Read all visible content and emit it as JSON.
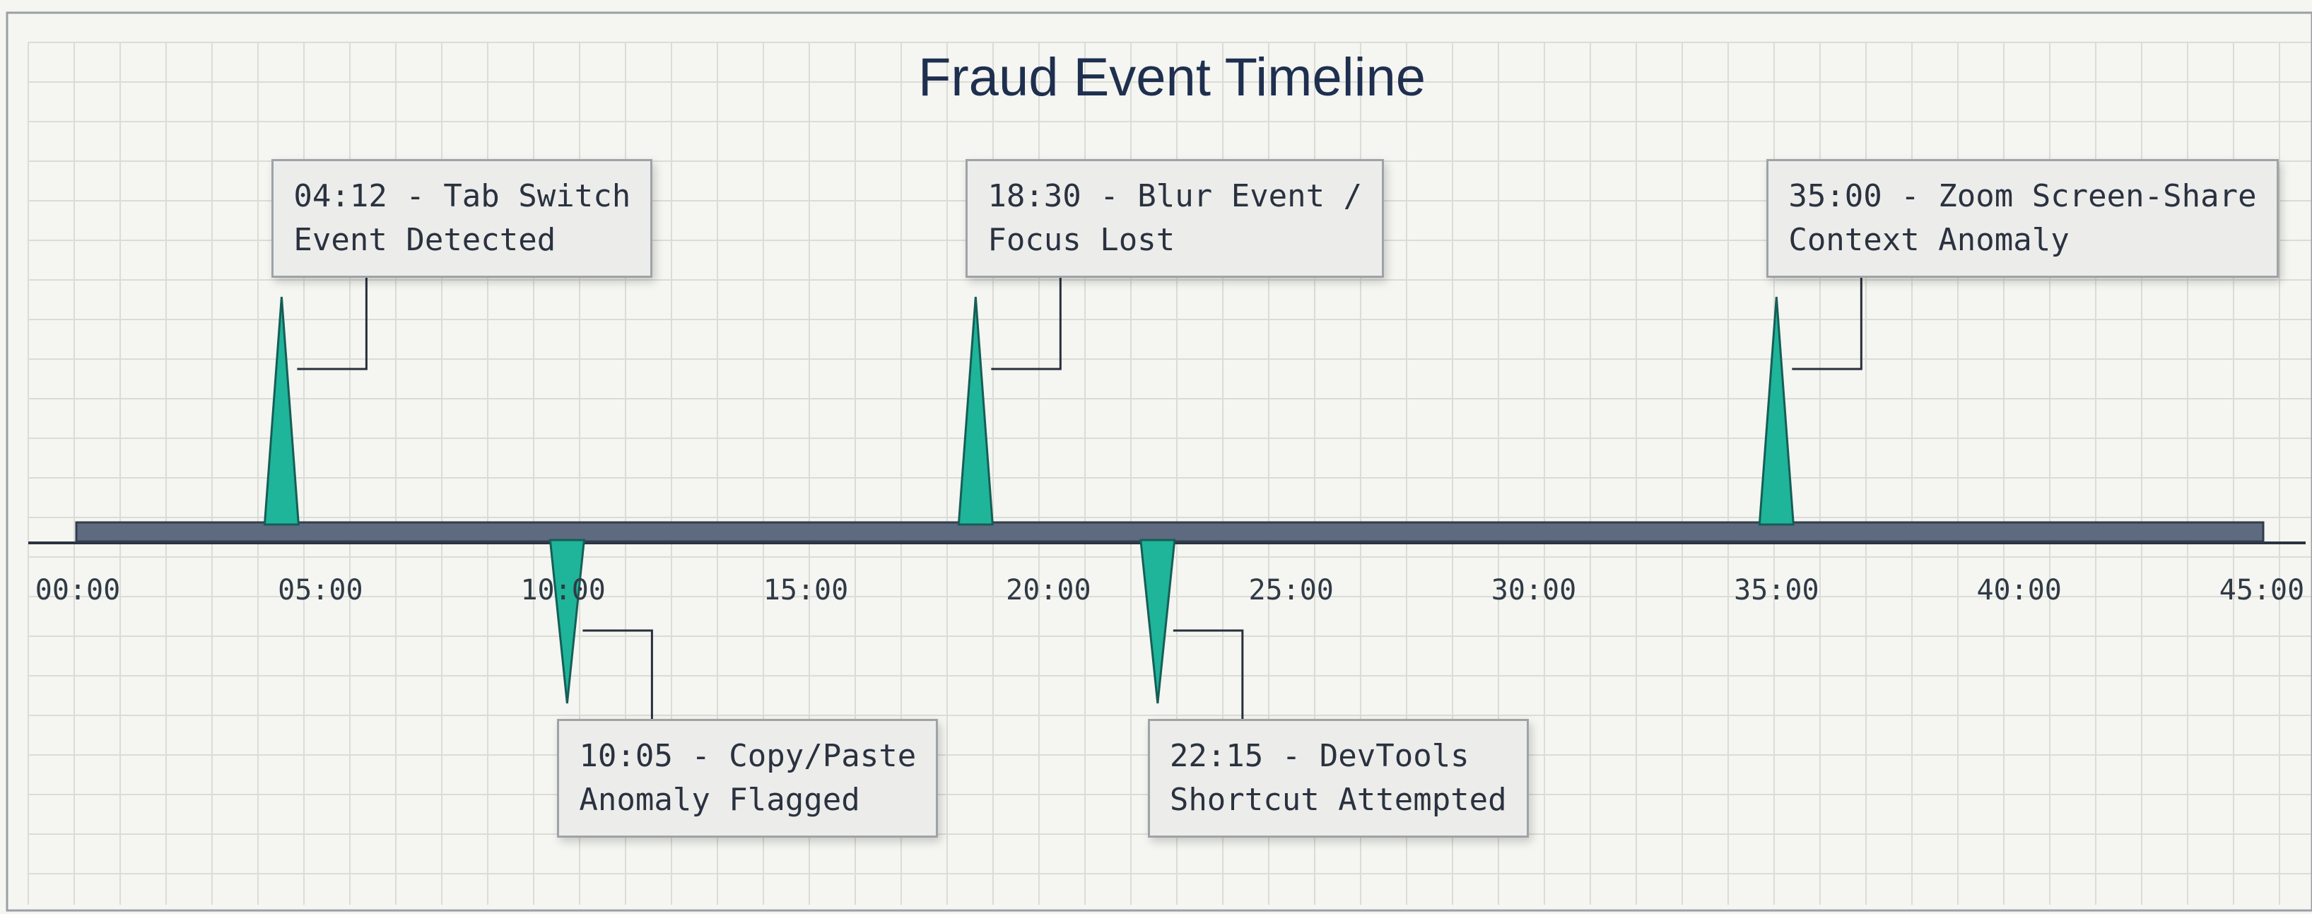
{
  "colors": {
    "background": "#f5f5f1",
    "grid": "#dcdcd6",
    "axis_bar": "#5e6a80",
    "spike": "#1fb59a",
    "spike_edge": "#155e56",
    "title": "#1e2f4f",
    "callout_bg": "#ececea",
    "callout_border": "#9ea3a8"
  },
  "chart_data": {
    "type": "timeline",
    "title": "Fraud Event Timeline",
    "xlim": [
      "00:00",
      "45:00"
    ],
    "ticks": [
      "00:00",
      "05:00",
      "10:00",
      "15:00",
      "20:00",
      "25:00",
      "30:00",
      "35:00",
      "40:00",
      "45:00"
    ],
    "grid": true,
    "events": [
      {
        "time": "04:12",
        "direction": "up",
        "label": "04:12 - Tab Switch\nEvent Detected"
      },
      {
        "time": "10:05",
        "direction": "down",
        "label": "10:05 - Copy/Paste\nAnomaly Flagged"
      },
      {
        "time": "18:30",
        "direction": "up",
        "label": "18:30 - Blur Event /\nFocus Lost"
      },
      {
        "time": "22:15",
        "direction": "down",
        "label": "22:15 - DevTools\nShortcut Attempted"
      },
      {
        "time": "35:00",
        "direction": "up",
        "label": "35:00 - Zoom Screen-Share\nContext Anomaly"
      }
    ]
  }
}
